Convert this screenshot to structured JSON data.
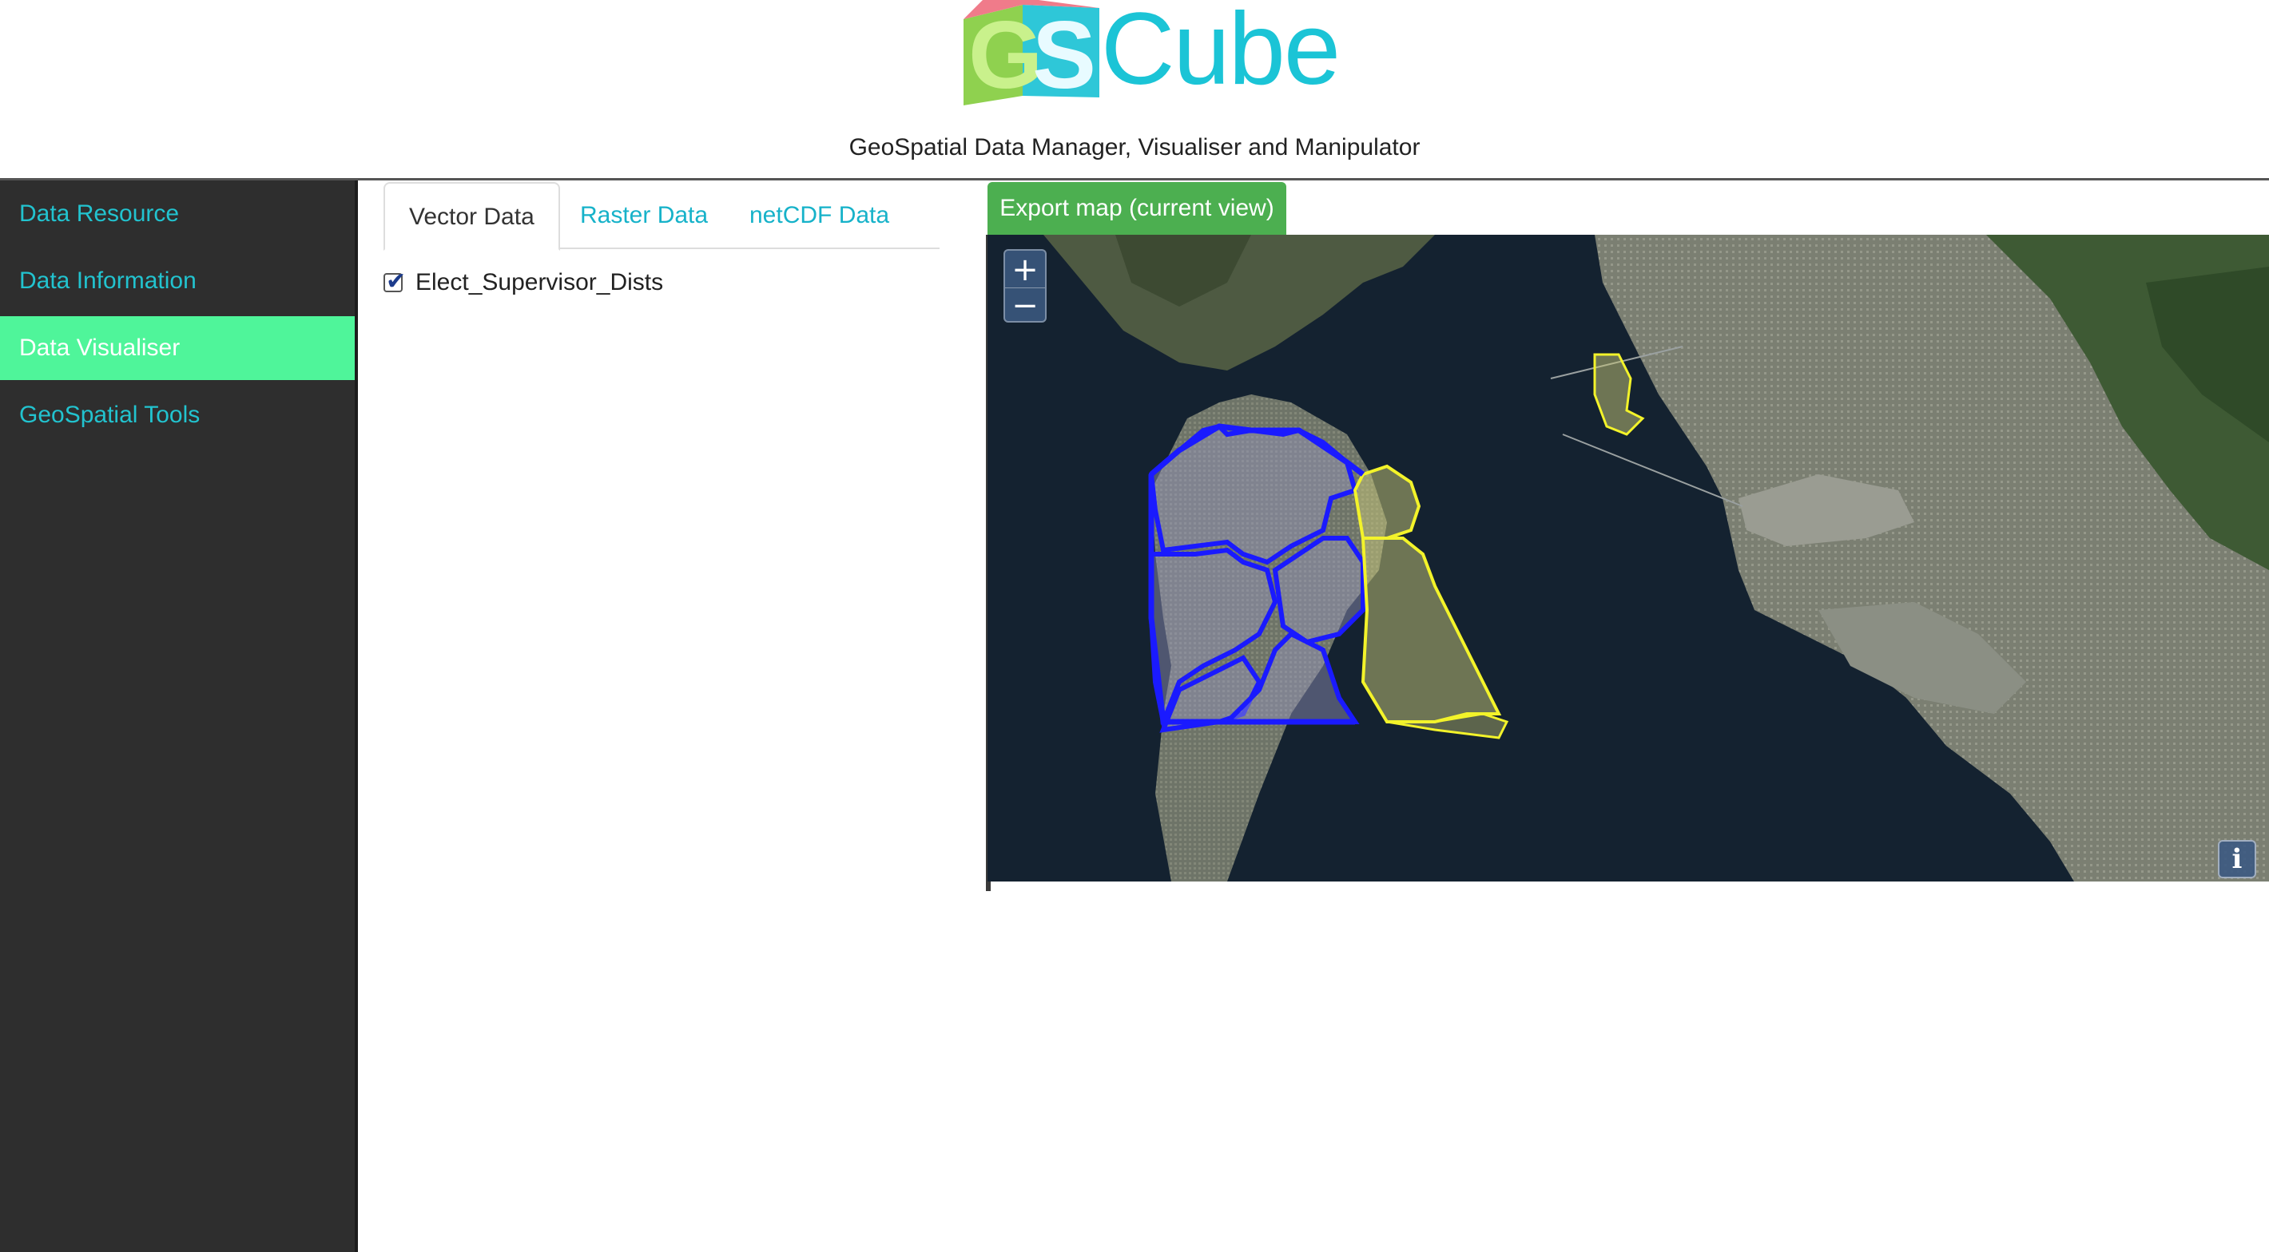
{
  "header": {
    "logo_text": "Cube",
    "logo_letters": "GS",
    "subtitle": "GeoSpatial Data Manager, Visualiser and Manipulator"
  },
  "sidebar": {
    "items": [
      {
        "label": "Data Resource",
        "active": false
      },
      {
        "label": "Data Information",
        "active": false
      },
      {
        "label": "Data Visualiser",
        "active": true
      },
      {
        "label": "GeoSpatial Tools",
        "active": false
      }
    ]
  },
  "tabs": [
    {
      "label": "Vector Data",
      "active": true
    },
    {
      "label": "Raster Data",
      "active": false
    },
    {
      "label": "netCDF Data",
      "active": false
    }
  ],
  "layers": [
    {
      "label": "Elect_Supervisor_Dists",
      "checked": true
    }
  ],
  "map": {
    "export_label": "Export map (current view)",
    "zoom_in_label": "+",
    "zoom_out_label": "−",
    "info_label": "i",
    "colors": {
      "water": "#142230",
      "land": "#5f6a5a",
      "district_blue": "#1a1aff",
      "district_yellow": "#f3f32a"
    }
  },
  "colors": {
    "accent": "#22c3cf",
    "sidebar_bg": "#2e2e2e",
    "active_item": "#4ff59a",
    "export_button": "#4caf50"
  }
}
